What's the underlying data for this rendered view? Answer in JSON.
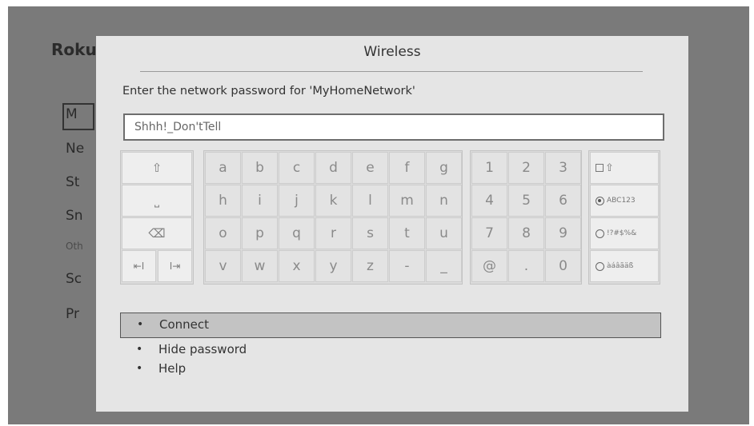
{
  "background_menu": {
    "logo": "Roku",
    "items": [
      "Ne",
      "St",
      "Sn",
      "Oth",
      "Sc",
      "Pr"
    ],
    "selected_item": "M"
  },
  "dialog": {
    "title": "Wireless",
    "prompt": "Enter the network password for 'MyHomeNetwork'",
    "password_value": "Shhh!_Don'tTell"
  },
  "keyboard": {
    "control_keys": {
      "shift": "⇧",
      "space": "⎵",
      "backspace": "⌫",
      "cursor_left": "⇤I",
      "cursor_right": "I⇥"
    },
    "letters": [
      [
        "a",
        "b",
        "c",
        "d",
        "e",
        "f",
        "g"
      ],
      [
        "h",
        "i",
        "j",
        "k",
        "l",
        "m",
        "n"
      ],
      [
        "o",
        "p",
        "q",
        "r",
        "s",
        "t",
        "u"
      ],
      [
        "v",
        "w",
        "x",
        "y",
        "z",
        "-",
        "_"
      ]
    ],
    "digits": [
      [
        "1",
        "2",
        "3"
      ],
      [
        "4",
        "5",
        "6"
      ],
      [
        "7",
        "8",
        "9"
      ],
      [
        "@",
        ".",
        "0"
      ]
    ],
    "modes": {
      "caps_lock_glyph": "⇧",
      "abc123": "ABC123",
      "symbols": "!?#$%&",
      "accents": "àáâãäß",
      "selected_mode": "ABC123"
    }
  },
  "options": [
    {
      "label": "Connect",
      "selected": true
    },
    {
      "label": "Hide password",
      "selected": false
    },
    {
      "label": "Help",
      "selected": false
    }
  ],
  "icons": [
    "shift-icon",
    "space-icon",
    "backspace-icon",
    "cursor-left-icon",
    "cursor-right-icon",
    "caps-lock-icon",
    "radio-icon",
    "bullet-icon"
  ]
}
